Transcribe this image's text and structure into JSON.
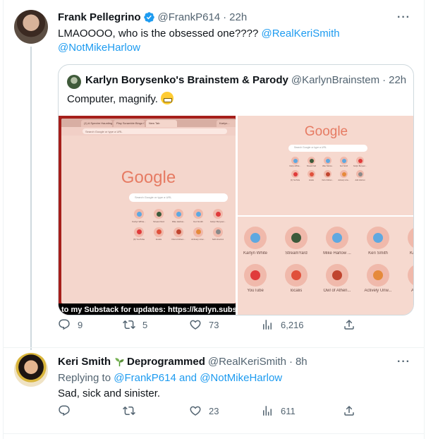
{
  "tweet1": {
    "display_name": "Frank Pellegrino",
    "handle": "@FrankP614",
    "time": "22h",
    "text_prefix": "LMAOOOO, who is the obsessed one????",
    "mention_1": "@RealKeriSmith",
    "mention_2": "@NotMikeHarlow",
    "more": "···",
    "quote": {
      "display_name": "Karlyn Borysenko's Brainstem & Parody",
      "handle": "@KarlynBrainstem",
      "time": "22h",
      "text": "Computer, magnify.",
      "media": {
        "tabs": [
          "(1) A Spectre Haunting...",
          "Play Scramble Bingo Online",
          "New Tab",
          "Karlyn..."
        ],
        "url_placeholder": "Search Google or type a URL",
        "google_text": "Google",
        "search_placeholder": "Search Google or type a URL",
        "caption": "to my Substack for updates: https://karlyn.substack",
        "shortcuts_small": [
          "Karlyn White...",
          "StreamYard",
          "Mike Harlow...",
          "Keri Smith",
          "Karlyn Borysen...",
          "(0) YouTube",
          "localis",
          "Owl of Athen...",
          "Actively Unw...",
          "Add shortcut"
        ],
        "shortcuts_zoom_row1": [
          "Karlyn White",
          "StreamYard",
          "Mike Harlow ...",
          "Keri Smith",
          "Karlyn Bo"
        ],
        "shortcuts_zoom_row2": [
          "YouTube",
          "localis",
          "Owl of Athen...",
          "Actively Unw...",
          "Add sho"
        ]
      }
    },
    "stats": {
      "replies": "9",
      "retweets": "5",
      "likes": "73",
      "views": "6,216"
    }
  },
  "tweet2": {
    "display_name": "Keri Smith",
    "name_suffix": "Deprogrammed",
    "handle": "@RealKeriSmith",
    "time": "8h",
    "replying_label": "Replying to",
    "replying_to_1": "@FrankP614",
    "replying_and": "and",
    "replying_to_2": "@NotMikeHarlow",
    "text": "Sad, sick and sinister.",
    "more": "···",
    "stats": {
      "replies": "",
      "retweets": "",
      "likes": "23",
      "views": "611"
    }
  },
  "colors": {
    "accent": "#1d9bf0",
    "text": "#0f1419",
    "muted": "#536471",
    "border": "#cfd9de"
  },
  "icons": {
    "verified": "verified-badge-icon",
    "seedling": "seedling-icon",
    "reply": "reply-icon",
    "retweet": "retweet-icon",
    "like": "like-icon",
    "views": "views-icon",
    "share": "share-icon"
  }
}
